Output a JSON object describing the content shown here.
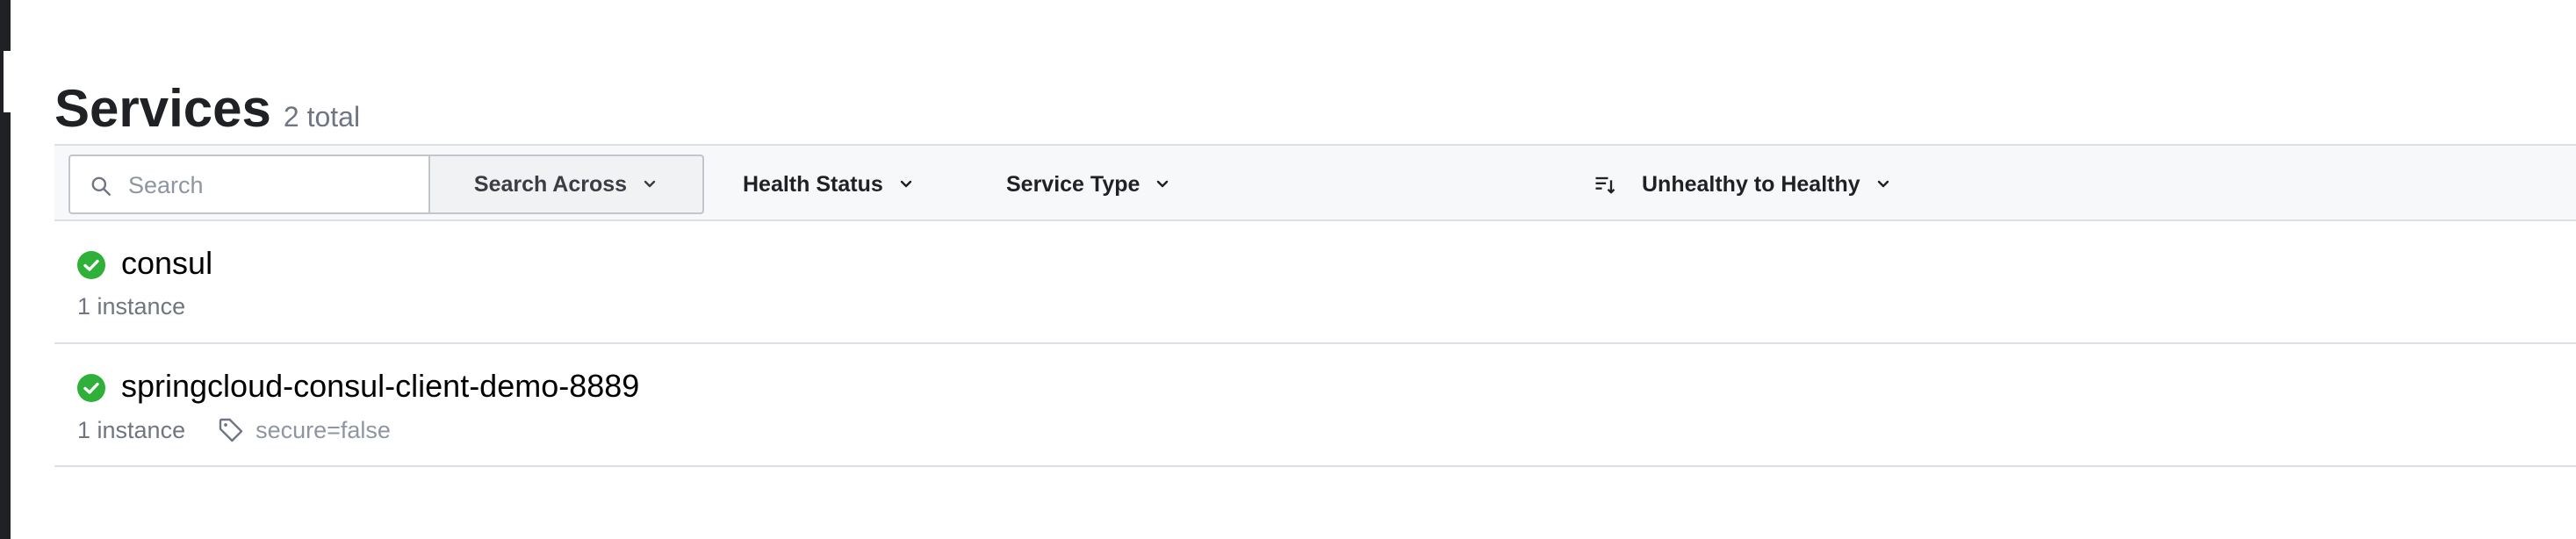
{
  "header": {
    "title": "Services",
    "count": "2 total"
  },
  "filters": {
    "search_placeholder": "Search",
    "search_across": "Search Across",
    "health_status": "Health Status",
    "service_type": "Service Type",
    "sort": "Unhealthy to Healthy"
  },
  "services": [
    {
      "name": "consul",
      "status": "passing",
      "instances": "1 instance",
      "tags": []
    },
    {
      "name": "springcloud-consul-client-demo-8889",
      "status": "passing",
      "instances": "1 instance",
      "tags": [
        "secure=false"
      ]
    }
  ],
  "colors": {
    "healthy": "#2eb039",
    "text": "#1f2124",
    "muted": "#6f7682",
    "border": "#dce0e6"
  },
  "icons": [
    "search-icon",
    "chevron-down-icon",
    "sort-icon",
    "check-circle-icon",
    "tag-icon"
  ]
}
